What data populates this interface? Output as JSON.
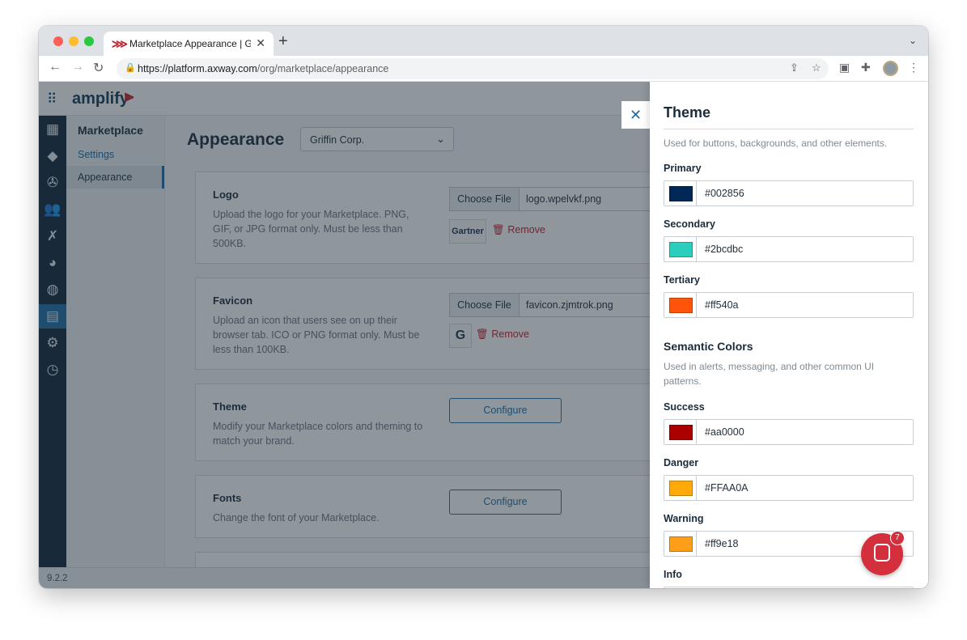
{
  "browser": {
    "tab_title": "Marketplace Appearance | Griffin",
    "url_host": "https://platform.axway.com",
    "url_path": "/org/marketplace/appearance"
  },
  "app": {
    "logo_text": "amplify",
    "version": "9.2.2"
  },
  "subnav": {
    "heading": "Marketplace",
    "items": [
      {
        "label": "Settings"
      },
      {
        "label": "Appearance"
      }
    ]
  },
  "page": {
    "title": "Appearance",
    "org_select": "Griffin Corp."
  },
  "cards": {
    "logo": {
      "title": "Logo",
      "description": "Upload the logo for your Marketplace. PNG, GIF, or JPG format only. Must be less than 500KB.",
      "choose_label": "Choose File",
      "file_name": "logo.wpelvkf.png",
      "thumb_text": "Gartner",
      "remove_label": "Remove"
    },
    "favicon": {
      "title": "Favicon",
      "description": "Upload an icon that users see on up their browser tab. ICO or PNG format only. Must be less than 100KB.",
      "choose_label": "Choose File",
      "file_name": "favicon.zjmtrok.png",
      "thumb_text": "G",
      "remove_label": "Remove"
    },
    "theme": {
      "title": "Theme",
      "description": "Modify your Marketplace colors and theming to match your brand.",
      "button": "Configure"
    },
    "fonts": {
      "title": "Fonts",
      "description": "Change the font of your Marketplace.",
      "button": "Configure"
    }
  },
  "drawer": {
    "title": "Theme",
    "theme_desc": "Used for buttons, backgrounds, and other elements.",
    "theme_colors": [
      {
        "label": "Primary",
        "hex": "#002856",
        "swatch": "#002856"
      },
      {
        "label": "Secondary",
        "hex": "#2bcdbc",
        "swatch": "#2bcdbc"
      },
      {
        "label": "Tertiary",
        "hex": "#ff540a",
        "swatch": "#ff540a"
      }
    ],
    "semantic_title": "Semantic Colors",
    "semantic_desc": "Used in alerts, messaging, and other common UI patterns.",
    "semantic_colors": [
      {
        "label": "Success",
        "hex": "#aa0000",
        "swatch": "#aa0000"
      },
      {
        "label": "Danger",
        "hex": "#FFAA0A",
        "swatch": "#FFAA0A"
      },
      {
        "label": "Warning",
        "hex": "#ff9e18",
        "swatch": "#ff9e18"
      }
    ],
    "info_label": "Info"
  },
  "chat": {
    "badge": "7"
  }
}
